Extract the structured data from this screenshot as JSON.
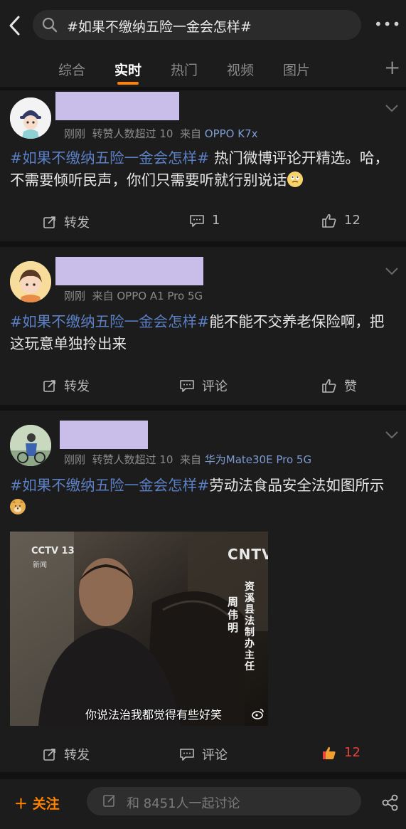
{
  "search": {
    "query": "#如果不缴纳五险一金会怎样#"
  },
  "more_label": "•••",
  "tabs": [
    {
      "label": "综合"
    },
    {
      "label": "实时",
      "active": true
    },
    {
      "label": "热门"
    },
    {
      "label": "视频"
    },
    {
      "label": "图片"
    }
  ],
  "add_tab_label": "+",
  "posts": [
    {
      "time": "刚刚",
      "repost_note": "转赞人数超过 10",
      "source_prefix": "来自",
      "source": "OPPO K7x",
      "topic": "#如果不缴纳五险一金会怎样#",
      "text": " 热门微博评论开精选。哈，不需要倾听民声，你们只需要听就行别说话",
      "emoji": "face-with-rolling-eyes-icon",
      "repost_label": "转发",
      "comment_label": "1",
      "like_label": "12"
    },
    {
      "time": "刚刚",
      "source_prefix": "来自",
      "source": "OPPO A1 Pro 5G",
      "topic": "#如果不缴纳五险一金会怎样#",
      "text": "能不能不交养老保险啊，把这玩意单独拎出来",
      "repost_label": "转发",
      "comment_label": "评论",
      "like_label": "赞"
    },
    {
      "time": "刚刚",
      "repost_note": "转赞人数超过 10",
      "source_prefix": "来自",
      "source": "华为Mate30E Pro 5G",
      "topic": "#如果不缴纳五险一金会怎样#",
      "text": "劳动法食品安全法如图所示",
      "emoji": "doge-icon",
      "image": {
        "channel_logo": "CCTV 13",
        "channel_sub": "新闻",
        "watermark": "CNTV",
        "caption_vertical_title": "资溪县法制办主任",
        "caption_vertical_name": "周伟明",
        "subtitle": "你说法治我都觉得有些好笑"
      },
      "repost_label": "转发",
      "comment_label": "评论",
      "like_label": "12"
    }
  ],
  "bottom": {
    "follow_label": "关注",
    "discuss_placeholder": "和 8451人一起讨论"
  },
  "colors": {
    "accent": "#ff8200",
    "topic": "#5b7fc4",
    "name_placeholder": "#c9bde9",
    "liked": "#e8433c"
  }
}
